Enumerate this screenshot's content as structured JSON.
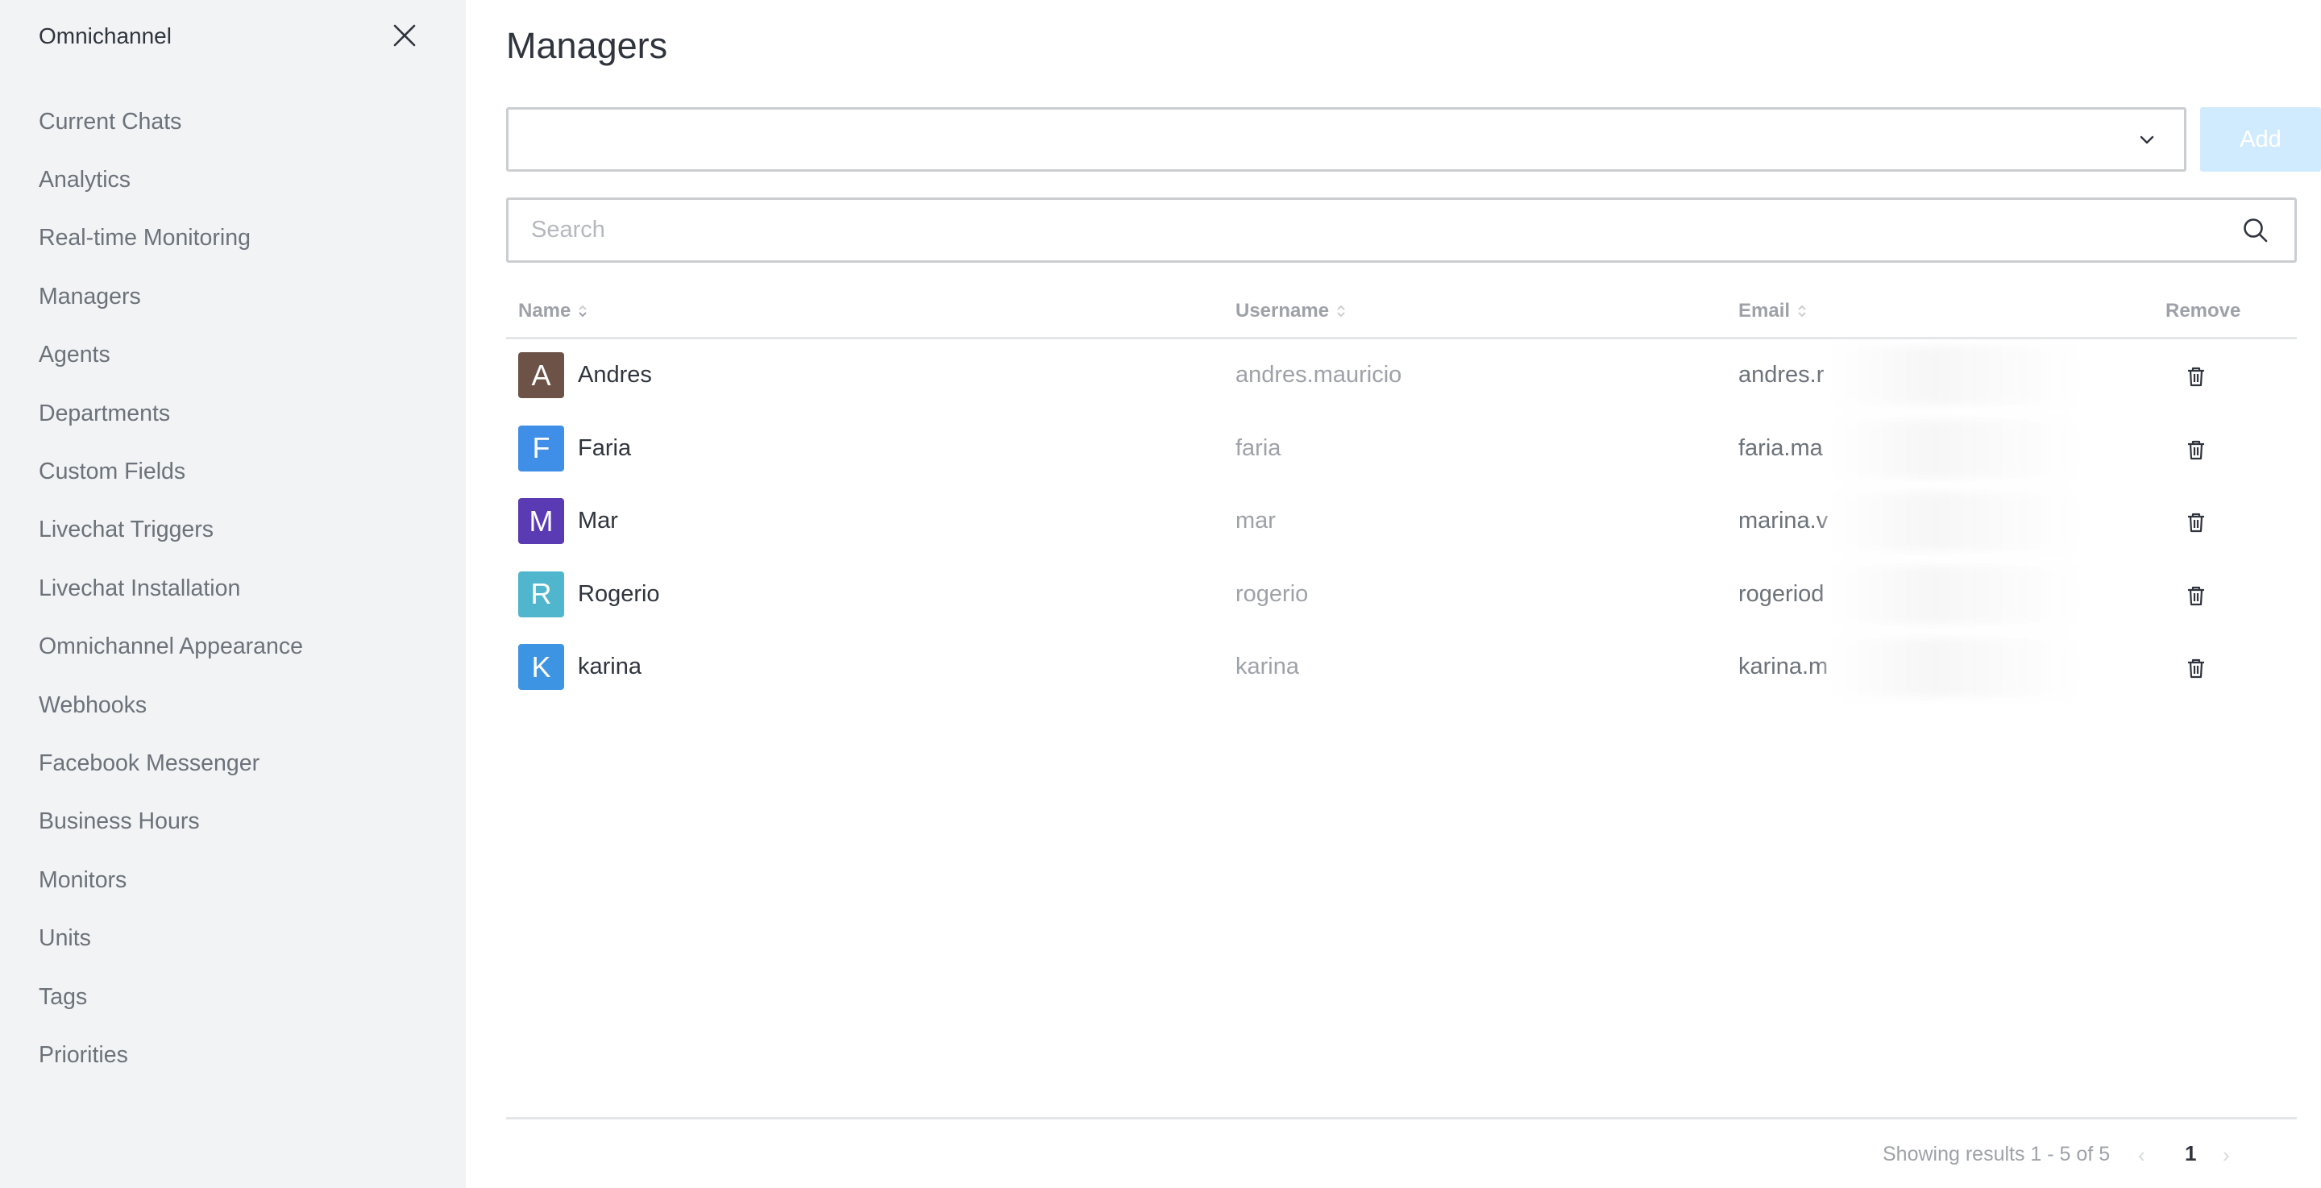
{
  "sidebar": {
    "title": "Omnichannel",
    "items": [
      {
        "label": "Current Chats"
      },
      {
        "label": "Analytics"
      },
      {
        "label": "Real-time Monitoring"
      },
      {
        "label": "Managers"
      },
      {
        "label": "Agents"
      },
      {
        "label": "Departments"
      },
      {
        "label": "Custom Fields"
      },
      {
        "label": "Livechat Triggers"
      },
      {
        "label": "Livechat Installation"
      },
      {
        "label": "Omnichannel Appearance"
      },
      {
        "label": "Webhooks"
      },
      {
        "label": "Facebook Messenger"
      },
      {
        "label": "Business Hours"
      },
      {
        "label": "Monitors"
      },
      {
        "label": "Units"
      },
      {
        "label": "Tags"
      },
      {
        "label": "Priorities"
      }
    ]
  },
  "page": {
    "title": "Managers",
    "add_label": "Add",
    "select_value": "",
    "search_placeholder": "Search"
  },
  "table": {
    "columns": {
      "name": "Name",
      "username": "Username",
      "email": "Email",
      "remove": "Remove"
    },
    "rows": [
      {
        "initial": "A",
        "name": "Andres",
        "username": "andres.mauricio",
        "email": "andres.r",
        "avatar_color": "#6d5247"
      },
      {
        "initial": "F",
        "name": "Faria",
        "username": "faria",
        "email": "faria.ma",
        "avatar_color": "#3f8fe8"
      },
      {
        "initial": "M",
        "name": "Mar",
        "username": "mar",
        "email": "marina.v",
        "avatar_color": "#5b3bb4"
      },
      {
        "initial": "R",
        "name": "Rogerio",
        "username": "rogerio",
        "email": "rogeriod",
        "avatar_color": "#4fb6cd"
      },
      {
        "initial": "K",
        "name": "karina",
        "username": "karina",
        "email": "karina.m",
        "avatar_color": "#3d94e2"
      }
    ]
  },
  "pagination": {
    "showing_text": "Showing results 1 - 5 of 5",
    "prev": "‹",
    "current_page": "1",
    "next": "›"
  }
}
